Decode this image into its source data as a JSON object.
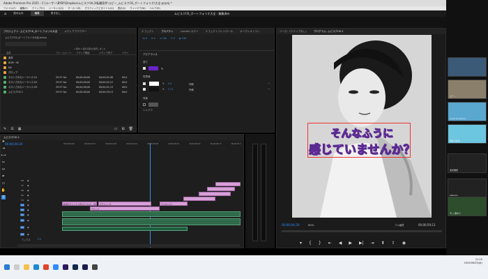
{
  "window": {
    "title": "Adobe Premiere Pro 2025 - C:\\ユーザー\\BYBY\\Dropbox\\ムビスク\\AL3\\転職案件\\コピー_ムビスクCK_ポートフォリオ\\大全.prproj *",
    "controls": [
      "—",
      "□",
      "✕"
    ]
  },
  "menu": [
    "ファイル(F)",
    "編集(E)",
    "クリップ(C)",
    "シーケンス(S)",
    "マーカー(M)",
    "グラフィックとタイトル(G)",
    "表示(V)",
    "ウィンドウ(W)",
    "ヘルプ(H)"
  ],
  "workspace": {
    "tabs": [
      "読み込み",
      "編集",
      "書き出し"
    ],
    "active": 1,
    "doc_title": "ムビスクCK_ポートフォリオ大全 - 編集済み"
  },
  "project_panel": {
    "tabs": [
      "プロジェクト: ムビスクCK_ポートフォリオ大全",
      "メディアブラウザー"
    ],
    "file": "ムビスクCK_ポートフォリオ大全.prproj",
    "selection_info": "1 個中 1 個の項目を選択しました",
    "columns": [
      "名前",
      "フレームレート",
      "メディア開始",
      "メディア終了",
      "メディ"
    ],
    "rows": [
      {
        "name": "素材",
        "color": "#e8a33c",
        "fr": "",
        "start": "",
        "end": "",
        "dur": ""
      },
      {
        "name": "BGM・SE",
        "color": "#e8a33c",
        "fr": "",
        "start": "",
        "end": "",
        "dur": ""
      },
      {
        "name": "NA",
        "color": "#e8a33c",
        "fr": "",
        "start": "",
        "end": "",
        "dur": ""
      },
      {
        "name": "グロップ",
        "color": "#e8a33c",
        "fr": "",
        "start": "",
        "end": "",
        "dur": ""
      },
      {
        "name": "ネストされたシーケンス 01",
        "color": "#4fb36b",
        "fr": "29.97 fps",
        "start": "00;00;00;00",
        "end": "00;00;01;08",
        "dur": "00;0"
      },
      {
        "name": "ネストされたシーケンス 02",
        "color": "#4fb36b",
        "fr": "29.97 fps",
        "start": "00;00;00;00",
        "end": "00;00;02;12",
        "dur": "00;0"
      },
      {
        "name": "ネストされたシーケンス 03",
        "color": "#4fb36b",
        "fr": "29.97 fps",
        "start": "00;00;00;00",
        "end": "00;00;01;15",
        "dur": "00;0"
      },
      {
        "name": "ムビスクCK 2",
        "color": "#4fb36b",
        "fr": "29.97 fps",
        "start": "00;00;00;00",
        "end": "00;00;59;13",
        "dur": "00;0"
      }
    ]
  },
  "effect_panel": {
    "tabs": [
      "エフェクト",
      "プロパティ",
      "Lumetri カラー",
      "エフェクトコントロール",
      "オーディオトラッ"
    ],
    "active": 1,
    "section_appearance": "アピアランス",
    "fill_label": "塗り",
    "fill_color": "#6a24c8",
    "stroke_label": "境界線",
    "stroke1_color": "#ffffff",
    "stroke1_width": "5.0",
    "stroke1_type": "外側",
    "stroke2_color": "#111111",
    "stroke2_width": "17.0",
    "stroke2_type": "外側",
    "bg_label": "背景",
    "shadow_label": "シャドウ"
  },
  "timeline": {
    "sequence_tab": "ムビスクCK 2",
    "timecode": "00;00;04;20",
    "ruler": [
      "00;00;03;00",
      "00;00;03;15",
      "00;00;04;00",
      "00;00;04;15",
      "00;00;05;00",
      "00;00;05;15",
      "00;00;06;00",
      "00;00;06;15",
      "00;00;07;1"
    ],
    "video_tracks": [
      "V8",
      "V7",
      "V6",
      "V5",
      "V4",
      "V3",
      "V2",
      "V1"
    ],
    "audio_tracks": [
      "A1",
      "A2",
      "A3"
    ],
    "clips": [
      "動画のクリップ_お互いについて、話してみたい",
      "グラフィック",
      "そんなふうに",
      "テロップ"
    ],
    "mix_label": "ミックス",
    "mix_value": "0.0"
  },
  "program_monitor": {
    "tabs": [
      "ソース：(クリップなし)",
      "プログラム: ムビスクCK 2"
    ],
    "subtitle_line1": "そんなふうに",
    "subtitle_line2": "感じていませんか？",
    "timecode": "00;00;04;20",
    "zoom": "60%",
    "quality": "フル画質",
    "duration": "00;00;59;13"
  },
  "meeting": {
    "participants": [
      {
        "name": "",
        "label_color": "#f0c040"
      },
      {
        "name": "ゴー...",
        "label_color": "#3a3a3a"
      },
      {
        "name": "unchi の iPhone",
        "label_color": "#3a3a3a"
      },
      {
        "name": "瑞穂 (坂井)",
        "label_color": "#3a3a3a"
      },
      {
        "name": "北村浩史",
        "label_color": "#3a3a3a"
      },
      {
        "name": "akikunn",
        "label_color": "#3a3a3a"
      },
      {
        "name": "モリ 豊ゆう",
        "label_color": "#3a3a3a"
      }
    ]
  },
  "taskbar": {
    "time": "21:15",
    "date": "2025/06/25(水)"
  }
}
